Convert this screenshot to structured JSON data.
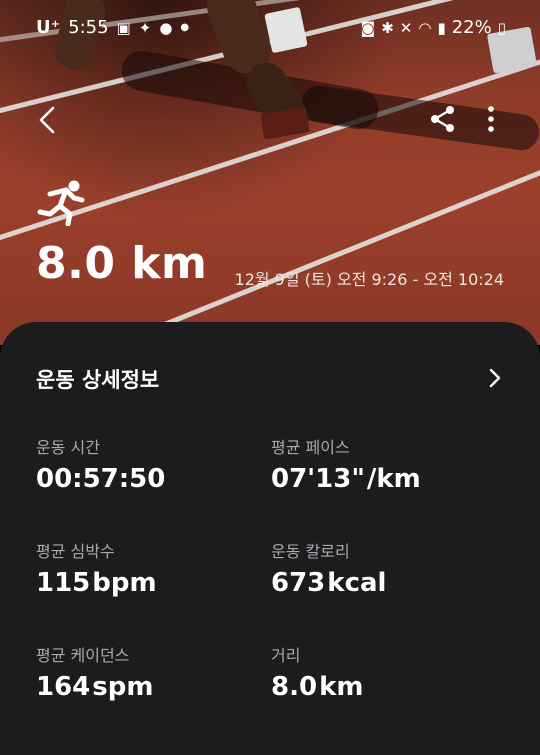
{
  "status_bar": {
    "carrier": "U⁺",
    "time": "5:55",
    "battery": "22%"
  },
  "topbar": {
    "back_icon": "chevron-left-icon",
    "share_icon": "share-icon",
    "more_icon": "more-vertical-icon"
  },
  "hero": {
    "activity_icon": "running-icon",
    "distance": "8.0 km",
    "datetime": "12월 9일 (토) 오전 9:26 - 오전 10:24"
  },
  "details": {
    "title": "운동 상세정보",
    "metrics": [
      {
        "label": "운동 시간",
        "value": "00:57:50",
        "unit": ""
      },
      {
        "label": "평균 페이스",
        "value": "07'13\"",
        "unit": "/km"
      },
      {
        "label": "평균 심박수",
        "value": "115",
        "unit": "bpm"
      },
      {
        "label": "운동 칼로리",
        "value": "673",
        "unit": "kcal"
      },
      {
        "label": "평균 케이던스",
        "value": "164",
        "unit": "spm"
      },
      {
        "label": "거리",
        "value": "8.0",
        "unit": "km"
      }
    ]
  },
  "colors": {
    "track": "#9b402c",
    "card_bg": "#1c1c1e",
    "label": "#a9a9ad"
  }
}
